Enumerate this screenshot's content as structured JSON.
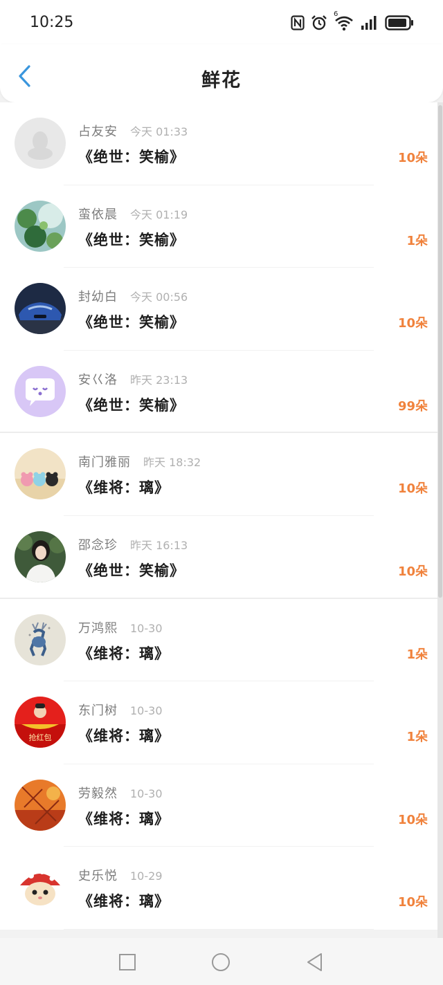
{
  "status": {
    "time": "10:25",
    "icons": [
      "nfc-icon",
      "alarm-icon",
      "wifi-6-icon",
      "signal-icon",
      "battery-icon"
    ],
    "wifi_badge": "6"
  },
  "header": {
    "title": "鲜花",
    "back_icon": "chevron-left-icon"
  },
  "colors": {
    "accent": "#3a96dd",
    "count": "#f0823c"
  },
  "list": [
    {
      "name": "占友安",
      "time": "今天 01:33",
      "book": "《绝世：笑榆》",
      "count": "10朵"
    },
    {
      "name": "蛮依晨",
      "time": "今天 01:19",
      "book": "《绝世：笑榆》",
      "count": "1朵"
    },
    {
      "name": "封幼白",
      "time": "今天 00:56",
      "book": "《绝世：笑榆》",
      "count": "10朵"
    },
    {
      "name": "安巜洛",
      "time": "昨天 23:13",
      "book": "《绝世：笑榆》",
      "count": "99朵"
    },
    {
      "name": "南门雅丽",
      "time": "昨天 18:32",
      "book": "《维将：璃》",
      "count": "10朵"
    },
    {
      "name": "邵念珍",
      "time": "昨天 16:13",
      "book": "《绝世：笑榆》",
      "count": "10朵"
    },
    {
      "name": "万鸿熙",
      "time": "10-30",
      "book": "《维将：璃》",
      "count": "1朵"
    },
    {
      "name": "东门树",
      "time": "10-30",
      "book": "《维将：璃》",
      "count": "1朵",
      "avatar_text": "抢红包"
    },
    {
      "name": "劳毅然",
      "time": "10-30",
      "book": "《维将：璃》",
      "count": "10朵"
    },
    {
      "name": "史乐悦",
      "time": "10-29",
      "book": "《维将：璃》",
      "count": "10朵"
    }
  ],
  "nav_keys": [
    "recent-apps-icon",
    "home-icon",
    "back-icon"
  ]
}
